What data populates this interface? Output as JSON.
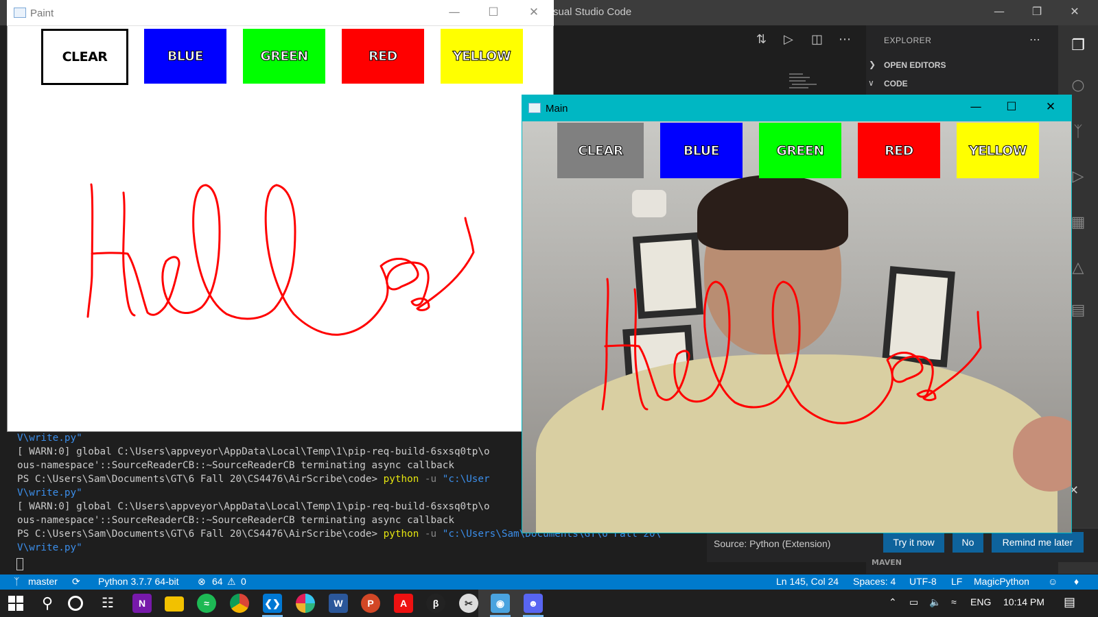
{
  "vscode": {
    "title": "Visual Studio Code",
    "title_visible": "sual Studio Code",
    "explorer": {
      "header": "EXPLORER",
      "sections": [
        "OPEN EDITORS",
        "CODE"
      ],
      "collapsed_section": "MAVEN"
    },
    "terminal": {
      "lines": [
        {
          "segments": [
            {
              "text": "V\\write.py\"",
              "style": "blue"
            }
          ]
        },
        {
          "segments": [
            {
              "text": "[ WARN:0] global C:\\Users\\appveyor\\AppData\\Local\\Temp\\1\\pip-req-build-6sxsq0tp\\o",
              "style": "plain"
            }
          ]
        },
        {
          "segments": [
            {
              "text": "ous-namespace'::SourceReaderCB::~SourceReaderCB terminating async callback",
              "style": "plain"
            }
          ]
        },
        {
          "segments": [
            {
              "text": "PS C:\\Users\\Sam\\Documents\\GT\\6 Fall 20\\CS4476\\AirScribe\\code> ",
              "style": "plain"
            },
            {
              "text": "python",
              "style": "yellow"
            },
            {
              "text": " -u ",
              "style": "gray"
            },
            {
              "text": "\"c:\\User",
              "style": "blue"
            }
          ]
        },
        {
          "segments": [
            {
              "text": "V\\write.py\"",
              "style": "blue"
            }
          ]
        },
        {
          "segments": [
            {
              "text": "[ WARN:0] global C:\\Users\\appveyor\\AppData\\Local\\Temp\\1\\pip-req-build-6sxsq0tp\\o",
              "style": "plain"
            }
          ]
        },
        {
          "segments": [
            {
              "text": "ous-namespace'::SourceReaderCB::~SourceReaderCB terminating async callback",
              "style": "plain"
            }
          ]
        },
        {
          "segments": [
            {
              "text": "PS C:\\Users\\Sam\\Documents\\GT\\6 Fall 20\\CS4476\\AirScribe\\code> ",
              "style": "plain"
            },
            {
              "text": "python",
              "style": "yellow"
            },
            {
              "text": " -u ",
              "style": "gray"
            },
            {
              "text": "\"c:\\Users\\Sam\\Documents\\GT\\6 Fall 20\\",
              "style": "blue"
            }
          ]
        },
        {
          "segments": [
            {
              "text": "V\\write.py\"",
              "style": "blue"
            }
          ]
        }
      ]
    },
    "notification": {
      "source": "Source: Python (Extension)",
      "buttons": [
        "Try it now",
        "No",
        "Remind me later"
      ]
    },
    "statusbar": {
      "branch": "master",
      "interpreter": "Python 3.7.7 64-bit",
      "errors": "64",
      "warnings": "0",
      "cursor": "Ln 145, Col 24",
      "spaces": "Spaces: 4",
      "encoding": "UTF-8",
      "eol": "LF",
      "language": "MagicPython"
    }
  },
  "paint_window": {
    "title": "Paint",
    "buttons": [
      {
        "label": "CLEAR",
        "color": "#ffffff",
        "text_color": "#000000"
      },
      {
        "label": "BLUE",
        "color": "#0000ff",
        "text_color": "#ffffff"
      },
      {
        "label": "GREEN",
        "color": "#00ff00",
        "text_color": "#ffffff"
      },
      {
        "label": "RED",
        "color": "#ff0000",
        "text_color": "#ffffff"
      },
      {
        "label": "YELLOW",
        "color": "#ffff00",
        "text_color": "#ffffff"
      }
    ],
    "stroke_color": "#ff0000"
  },
  "main_window": {
    "title": "Main",
    "buttons": [
      {
        "label": "CLEAR",
        "color": "#808080",
        "text_color": "#ffffff"
      },
      {
        "label": "BLUE",
        "color": "#0000ff",
        "text_color": "#ffffff"
      },
      {
        "label": "GREEN",
        "color": "#00ff00",
        "text_color": "#ffffff"
      },
      {
        "label": "RED",
        "color": "#ff0000",
        "text_color": "#ffffff"
      },
      {
        "label": "YELLOW",
        "color": "#ffff00",
        "text_color": "#ffffff"
      }
    ],
    "stroke_color": "#ff0000"
  },
  "taskbar": {
    "icons": [
      "windows-start-icon",
      "search-icon",
      "cortana-icon",
      "task-view-icon",
      "onenote-icon",
      "file-explorer-icon",
      "spotify-icon",
      "chrome-icon",
      "vscode-icon",
      "slack-icon",
      "word-icon",
      "powerpoint-icon",
      "acrobat-icon",
      "python-icon",
      "snipping-icon",
      "camera-app-icon",
      "discord-icon"
    ],
    "language": "ENG",
    "time": "10:14 PM"
  }
}
